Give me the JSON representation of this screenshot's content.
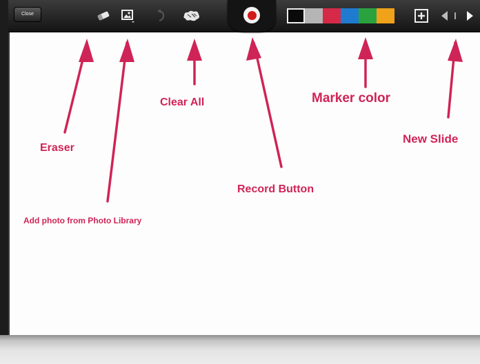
{
  "toolbar": {
    "close_label": "Close",
    "tools": [
      {
        "icon": "eraser-icon"
      },
      {
        "icon": "photo-library-icon"
      },
      {
        "icon": "undo-icon"
      },
      {
        "icon": "clear-all-icon"
      }
    ],
    "record": {
      "icon": "record-icon"
    },
    "colors": [
      "#0a0a0a",
      "#b5b5b5",
      "#d42a48",
      "#1f7bd0",
      "#2aa33e",
      "#f0a21a"
    ],
    "selected_color_index": 0,
    "add_slide_icon": "add-slide-icon",
    "prev_icon": "prev-arrow-icon",
    "next_icon": "next-arrow-icon"
  },
  "annotations": {
    "eraser": "Eraser",
    "add_photo": "Add photo from Photo Library",
    "clear_all": "Clear All",
    "record_button": "Record Button",
    "marker_color": "Marker color",
    "new_slide": "New Slide",
    "color": "#cf2457"
  }
}
